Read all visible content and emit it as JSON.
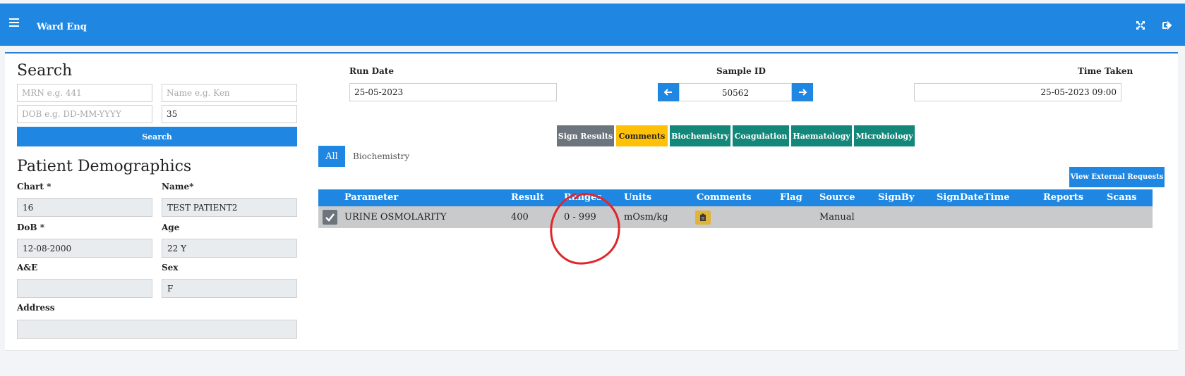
{
  "header": {
    "title": "Ward Enq",
    "icons": [
      "menu-icon",
      "expand-icon",
      "logout-icon"
    ]
  },
  "search": {
    "heading": "Search",
    "mrn_placeholder": "MRN e.g. 441",
    "name_placeholder": "Name e.g. Ken",
    "dob_placeholder": "DOB e.g. DD-MM-YYYY",
    "fourth_value": "35",
    "button_label": "Search"
  },
  "demographics": {
    "heading": "Patient Demographics",
    "chart_label": "Chart *",
    "chart_value": "16",
    "name_label": "Name*",
    "name_value": "TEST PATIENT2",
    "dob_label": "DoB *",
    "dob_value": "12-08-2000",
    "age_label": "Age",
    "age_value": "22 Y",
    "ae_label": "A&E",
    "ae_value": "",
    "sex_label": "Sex",
    "sex_value": "F",
    "address_label": "Address",
    "address_value": ""
  },
  "run": {
    "run_date_label": "Run Date",
    "run_date_value": "25-05-2023",
    "sample_label": "Sample ID",
    "sample_value": "50562",
    "time_label": "Time Taken",
    "time_value": "25-05-2023 09:00"
  },
  "actions": {
    "sign_results": "Sign Results",
    "comments": "Comments",
    "biochemistry": "Biochemistry",
    "coagulation": "Coagulation",
    "haematology": "Haematology",
    "microbiology": "Microbiology"
  },
  "filter": {
    "all": "All",
    "biochemistry": "Biochemistry"
  },
  "external_requests_label": "View External Requests",
  "table": {
    "columns": [
      "Parameter",
      "Result",
      "Ranges",
      "Units",
      "Comments",
      "Flag",
      "Source",
      "SignBy",
      "SignDateTime",
      "Reports",
      "Scans"
    ],
    "rows": [
      {
        "parameter": "URINE OSMOLARITY",
        "result": "400",
        "ranges": "0 - 999",
        "units": "mOsm/kg",
        "flag": "",
        "source": "Manual",
        "sign_by": "",
        "sign_date_time": "",
        "reports": "",
        "scans": ""
      }
    ]
  },
  "colors": {
    "primary": "#1f87e2",
    "teal": "#12877a",
    "warning": "#ffc107",
    "secondary": "#6c757d",
    "annotation": "#e0262c"
  }
}
